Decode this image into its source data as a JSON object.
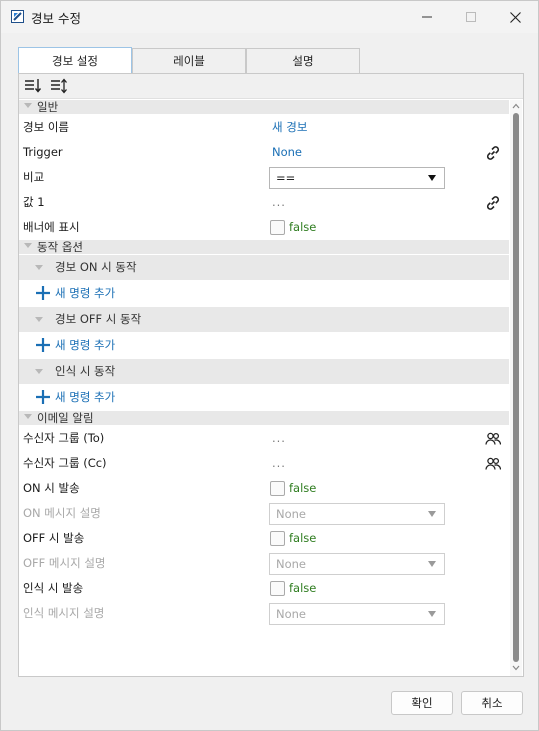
{
  "window": {
    "title": "경보 수정",
    "controls": {
      "minimize": "minimize",
      "maximize": "maximize",
      "close": "close"
    }
  },
  "tabs": [
    {
      "label": "경보 설정",
      "active": true
    },
    {
      "label": "레이블",
      "active": false
    },
    {
      "label": "설명",
      "active": false
    }
  ],
  "toolbar": {
    "icons": [
      "sort-categorized-icon",
      "sort-alphabetical-icon"
    ]
  },
  "sections": {
    "general": {
      "label": "일반",
      "alarm_name": {
        "label": "경보 이름",
        "value": "새 경보"
      },
      "trigger": {
        "label": "Trigger",
        "value": "None"
      },
      "compare": {
        "label": "비교",
        "value": "=="
      },
      "value1": {
        "label": "값 1",
        "value": "..."
      },
      "show_banner": {
        "label": "배너에 표시",
        "value": "false"
      }
    },
    "actions": {
      "label": "동작 옵션",
      "on": {
        "label": "경보 ON 시 동작",
        "add": "새 명령 추가"
      },
      "off": {
        "label": "경보 OFF 시 동작",
        "add": "새 명령 추가"
      },
      "ack": {
        "label": "인식 시 동작",
        "add": "새 명령 추가"
      }
    },
    "email": {
      "label": "이메일 알림",
      "to": {
        "label": "수신자 그룹 (To)",
        "value": "..."
      },
      "cc": {
        "label": "수신자 그룹 (Cc)",
        "value": "..."
      },
      "on_send": {
        "label": "ON 시 발송",
        "value": "false"
      },
      "on_msg": {
        "label": "ON 메시지 설명",
        "value": "None"
      },
      "off_send": {
        "label": "OFF 시 발송",
        "value": "false"
      },
      "off_msg": {
        "label": "OFF 메시지 설명",
        "value": "None"
      },
      "ack_send": {
        "label": "인식 시 발송",
        "value": "false"
      },
      "ack_msg": {
        "label": "인식 메시지 설명",
        "value": "None"
      }
    }
  },
  "buttons": {
    "ok": "확인",
    "cancel": "취소"
  },
  "colors": {
    "accent": "#1a6fb5",
    "bool": "#2f7d20",
    "category": "#e8e8e8"
  }
}
